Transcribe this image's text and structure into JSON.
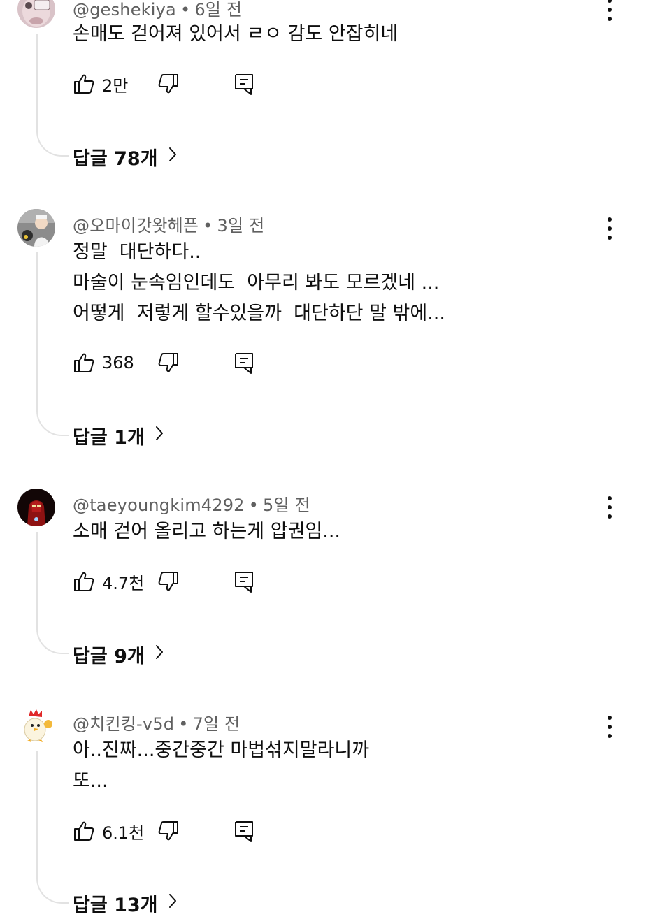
{
  "comments": [
    {
      "handle": "@geshekiya",
      "time": "6일 전",
      "lines": [
        "손매도 걷어져 있어서 ㄹㅇ 감도 안잡히네"
      ],
      "likes": "2만",
      "replies_label": "답글 78개"
    },
    {
      "handle": "@오마이갓왓헤픈",
      "time": "3일 전",
      "lines": [
        "정말  대단하다..",
        "마술이 눈속임인데도  아무리 봐도 모르겠네 ...",
        "어떻게  저렇게 할수있을까  대단하단 말 밖에..."
      ],
      "likes": "368",
      "replies_label": "답글 1개"
    },
    {
      "handle": "@taeyoungkim4292",
      "time": "5일 전",
      "lines": [
        "소매 걷어 올리고 하는게 압권임..."
      ],
      "likes": "4.7천",
      "replies_label": "답글 9개"
    },
    {
      "handle": "@치킨킹-v5d",
      "time": "7일 전",
      "lines": [
        "아..진짜...중간중간 마법섞지말라니까",
        "또..."
      ],
      "likes": "6.1천",
      "replies_label": "답글 13개"
    }
  ],
  "meta_separator": "•",
  "icons": {
    "like": "thumbs-up-icon",
    "dislike": "thumbs-down-icon",
    "reply": "reply-comment-icon",
    "more": "more-vertical-icon",
    "chevron": "chevron-right-icon"
  },
  "colors": {
    "text": "#0f0f0f",
    "secondary": "#606060",
    "thread_line": "#e2e2e2"
  }
}
